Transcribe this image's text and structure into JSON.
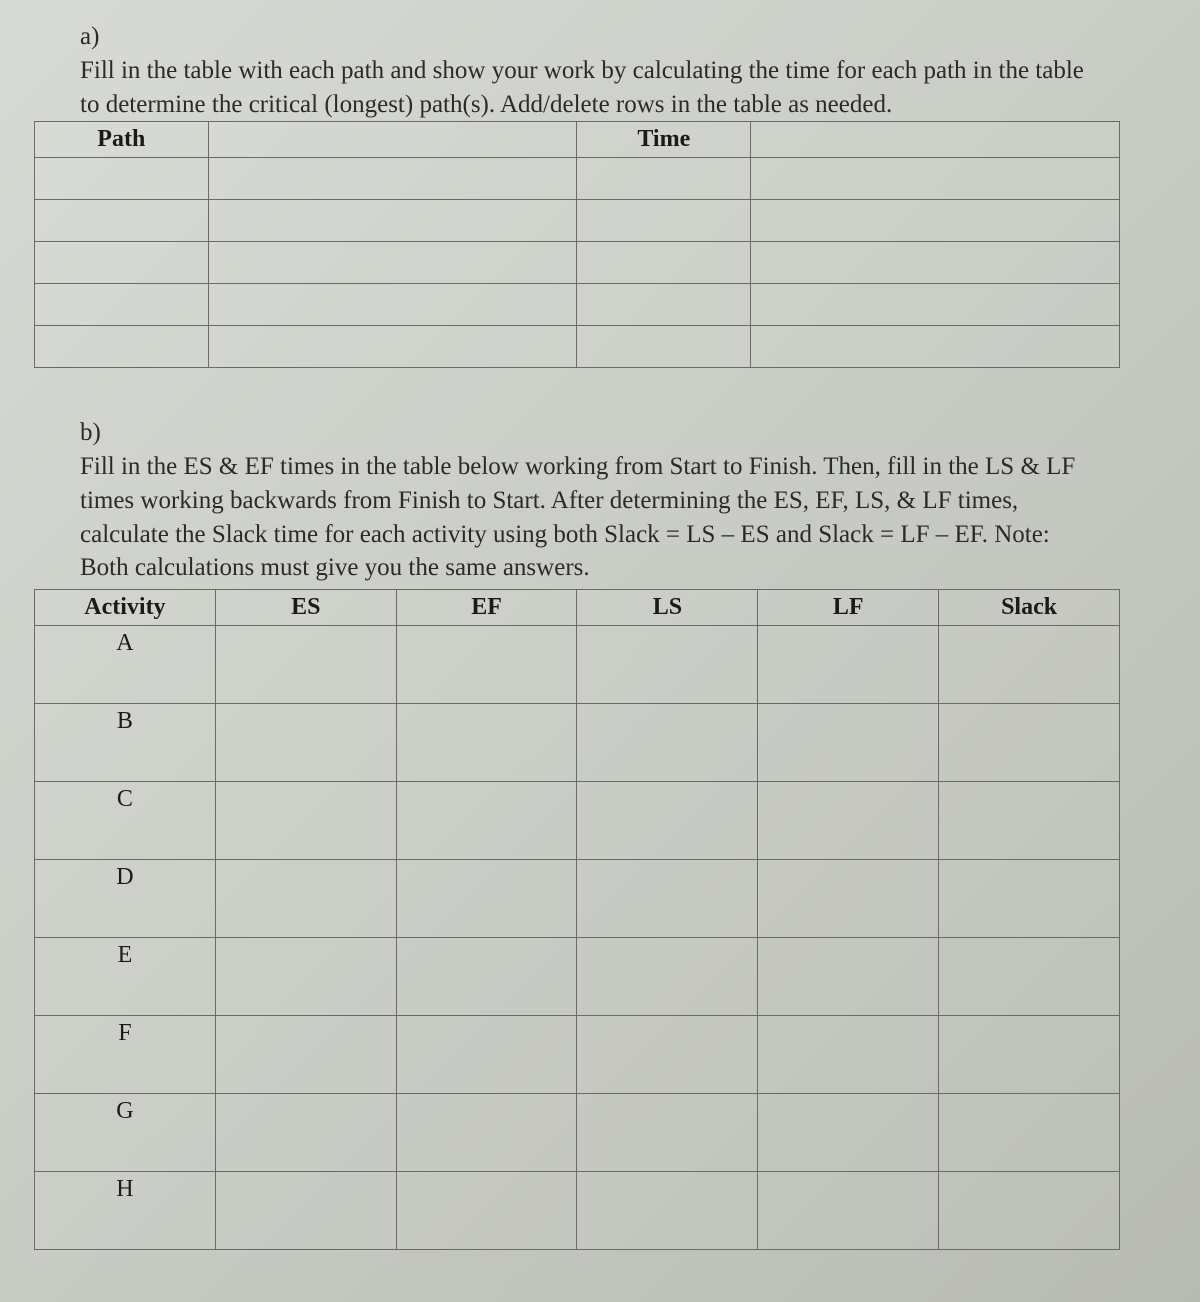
{
  "a": {
    "label": "a)",
    "text": "Fill in the table with each path and show your work by calculating the time for each path in the table to determine the critical (longest) path(s). Add/delete rows in the table as needed.",
    "headers": {
      "path": "Path",
      "time": "Time"
    },
    "rows": 5
  },
  "b": {
    "label": "b)",
    "text": "Fill in the ES & EF times in the table below working from Start to Finish. Then, fill in the LS & LF times working backwards from Finish to Start. After determining the ES, EF, LS, & LF times, calculate the Slack time for each activity using both Slack = LS – ES and Slack = LF – EF. Note: Both calculations must give you the same answers.",
    "headers": {
      "activity": "Activity",
      "es": "ES",
      "ef": "EF",
      "ls": "LS",
      "lf": "LF",
      "slack": "Slack"
    },
    "activities": [
      "A",
      "B",
      "C",
      "D",
      "E",
      "F",
      "G",
      "H"
    ]
  }
}
